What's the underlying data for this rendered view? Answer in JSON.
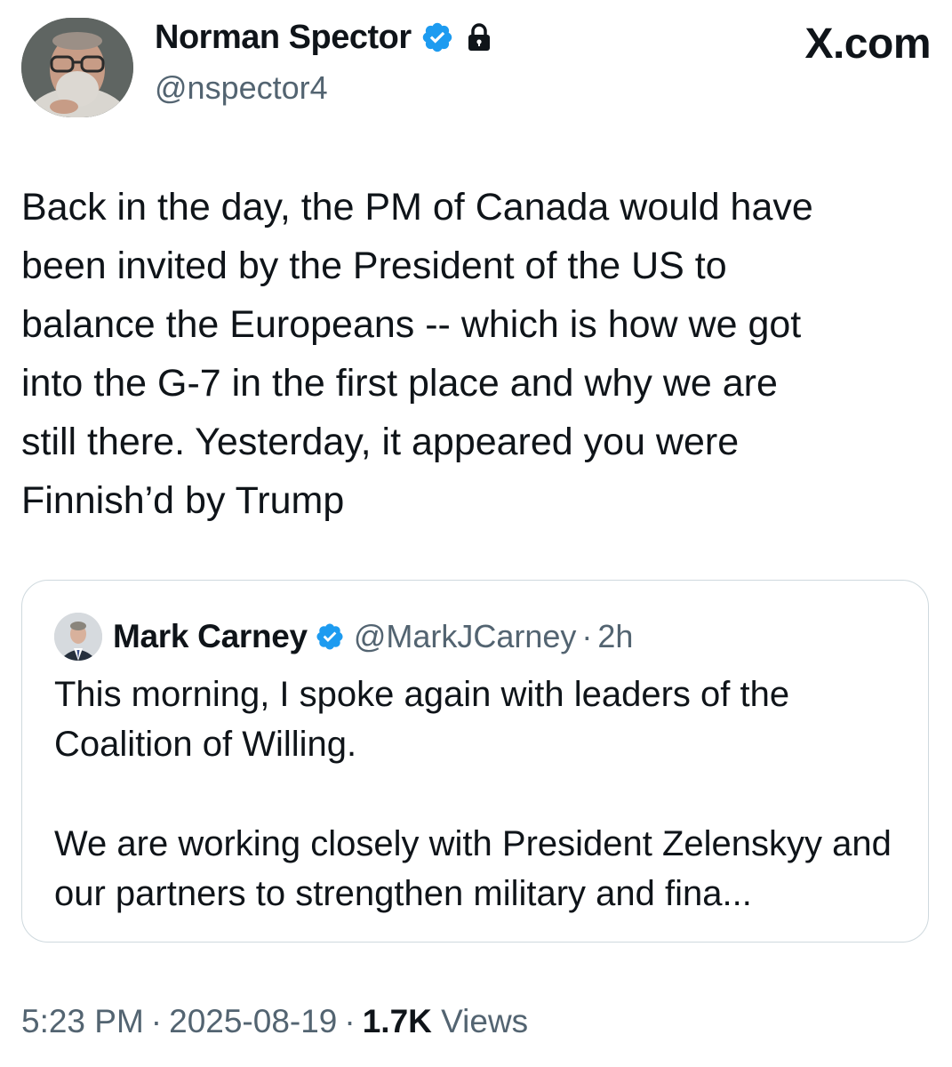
{
  "author": {
    "display_name": "Norman Spector",
    "handle": "@nspector4",
    "verified_badge_icon": "verified-badge-icon",
    "protected_icon": "lock-icon"
  },
  "site_label": "X.com",
  "tweet": {
    "text": "Back in the day, the PM of Canada would have\nbeen invited by the President of the US to\nbalance the Europeans -- which is how we got\ninto the G-7 in the first place and why we are\nstill there. Yesterday, it appeared you were\nFinnish’d by Trump"
  },
  "quoted_tweet": {
    "display_name": "Mark Carney",
    "handle": "@MarkJCarney",
    "separator": "·",
    "time": "2h",
    "paragraph_1": "This morning, I spoke again with leaders of the Coalition of Willing.",
    "paragraph_2": "We are working closely with President Zelenskyy and our partners to strengthen military and fina..."
  },
  "meta": {
    "time": "5:23 PM",
    "separator": "·",
    "date": "2025-08-19",
    "views_count": "1.7K",
    "views_label": "Views"
  },
  "colors": {
    "text_primary": "#0f1419",
    "text_secondary": "#536471",
    "verified_blue": "#1d9bf0",
    "card_border": "#cfd9de"
  }
}
